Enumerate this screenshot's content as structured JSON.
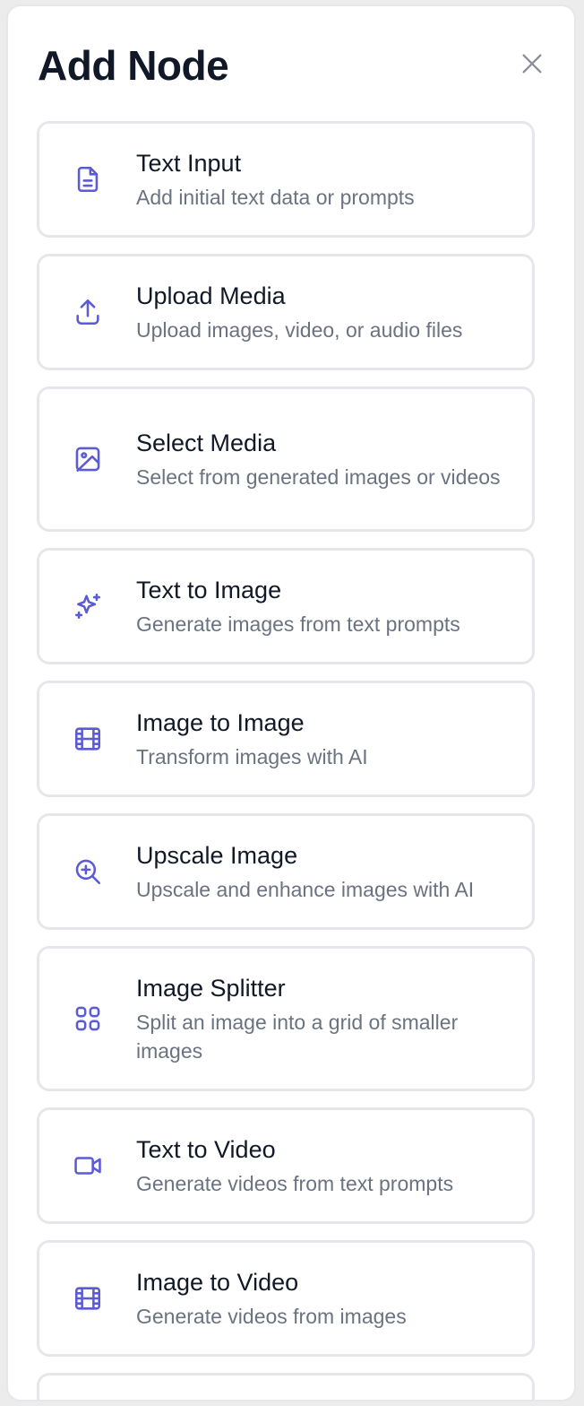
{
  "dialog": {
    "title": "Add Node",
    "close_icon": "close-icon",
    "accent_color": "#5b5bd6"
  },
  "items": [
    {
      "title": "Text Input",
      "description": "Add initial text data or prompts",
      "icon": "document-icon"
    },
    {
      "title": "Upload Media",
      "description": "Upload images, video, or audio files",
      "icon": "upload-icon"
    },
    {
      "title": "Select Media",
      "description": "Select from generated images or videos",
      "icon": "image-icon"
    },
    {
      "title": "Text to Image",
      "description": "Generate images from text prompts",
      "icon": "sparkles-icon"
    },
    {
      "title": "Image to Image",
      "description": "Transform images with AI",
      "icon": "film-icon"
    },
    {
      "title": "Upscale Image",
      "description": "Upscale and enhance images with AI",
      "icon": "zoom-in-icon"
    },
    {
      "title": "Image Splitter",
      "description": "Split an image into a grid of smaller images",
      "icon": "grid-icon"
    },
    {
      "title": "Text to Video",
      "description": "Generate videos from text prompts",
      "icon": "video-icon"
    },
    {
      "title": "Image to Video",
      "description": "Generate videos from images",
      "icon": "film-icon"
    }
  ]
}
